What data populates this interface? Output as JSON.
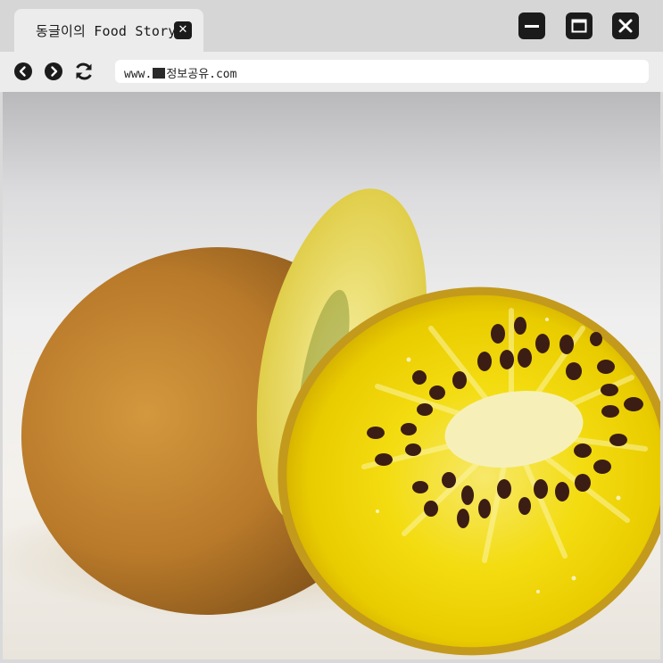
{
  "tab": {
    "title": "동글이의 Food Story",
    "close_icon": "close-icon"
  },
  "window_controls": [
    "minimize-icon",
    "maximize-icon",
    "close-icon"
  ],
  "nav": {
    "back_icon": "chevron-left-icon",
    "forward_icon": "chevron-right-icon",
    "reload_icon": "reload-icon"
  },
  "address": {
    "prefix": "www.",
    "redacted": true,
    "domain_text": "정보공유.com"
  },
  "content": {
    "image_subject": "kiwi-photo",
    "colors": {
      "flesh": "#f3d400",
      "skin": "#b97a2a",
      "core": "#f6f0b8",
      "seed": "#3b1d14"
    }
  },
  "colors": {
    "chrome": "#d6d6d6",
    "tab_active": "#ececec",
    "control": "#1b1b1b",
    "urlbox": "#ffffff"
  }
}
